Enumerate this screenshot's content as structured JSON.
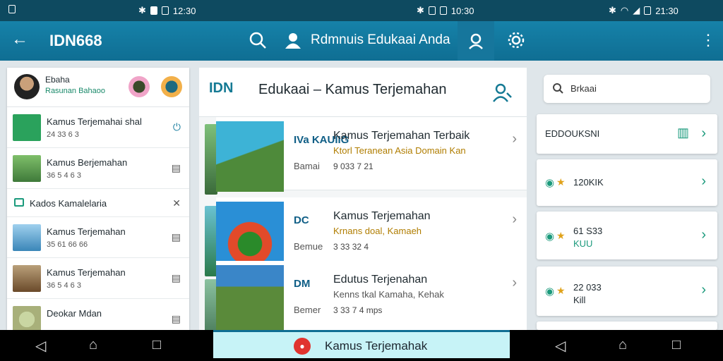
{
  "status_bar": {
    "left_time": "12:30",
    "center_time": "10:30",
    "right_time": "21:30"
  },
  "app_bar": {
    "title": "IDN668",
    "subtitle": "Rdmnuis Edukaai Anda"
  },
  "left_panel": {
    "account": {
      "name": "Ebaha",
      "sub": "Rasunan Bahaoo"
    },
    "items": [
      {
        "title": "Kamus Terjemahai shal",
        "meta": "24 33 6 3"
      },
      {
        "title": "Kamus Berjemahan",
        "meta": "36 5 4 6 3"
      }
    ],
    "banner": "Kados Kamalelaria",
    "items2": [
      {
        "title": "Kamus Terjemahan",
        "meta": "35 61 66 66"
      },
      {
        "title": "Kamus Terjemahan",
        "meta": "36 5 4 6 3"
      },
      {
        "title": "Deokar Mdan",
        "meta": ""
      }
    ]
  },
  "center_panel": {
    "logo": "IDN",
    "header_title": "Edukaai – Kamus Terjemahan",
    "cards": [
      {
        "brand": "IVa KAUIIG",
        "title": "Kamus Terjemahan Terbaik",
        "subtitle": "Ktorl Teranean Asia Domain Kan",
        "meta": "Bamai",
        "value": "9 033 7 21"
      },
      {
        "brand": "DC",
        "title": "Kamus Terjemahan",
        "subtitle": "Krnans doal, Kamaeh",
        "meta": "Bemue",
        "value": "3 33 32 4"
      },
      {
        "brand": "DM",
        "title": "Edutus Terjenahan",
        "subtitle": "Kenns tkal Kamaha, Kehak",
        "meta": "Bemer",
        "value": "3 33 7 4 mps"
      }
    ]
  },
  "right_panel": {
    "search_text": "Brkaai",
    "cards": [
      {
        "label": "EDDOUKSNI"
      },
      {
        "label": "120KIK"
      },
      {
        "label": "61 S33",
        "sub": "KUU"
      },
      {
        "label": "22 033",
        "sub": "Kill"
      }
    ]
  },
  "toast": {
    "label": "Kamus Terjemahak"
  },
  "colors": {
    "appbar": "#1682a9",
    "accent": "#1b9a7c"
  }
}
